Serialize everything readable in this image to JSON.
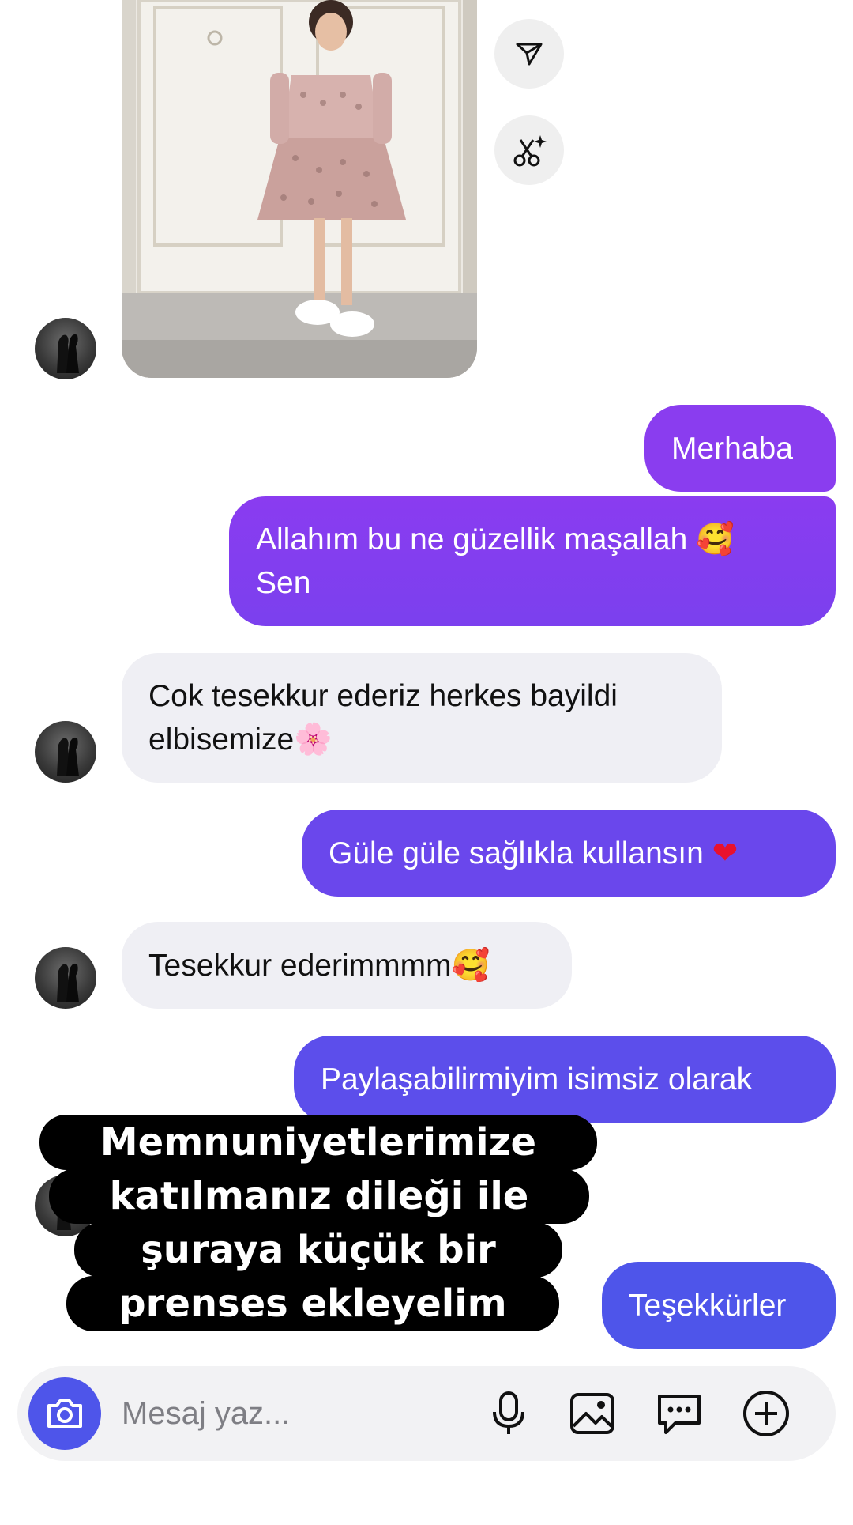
{
  "thread": {
    "photo_alt": "Shared photo: girl in a patterned dress",
    "messages": [
      {
        "id": "m1",
        "direction": "out",
        "text": "Merhaba"
      },
      {
        "id": "m2",
        "direction": "out",
        "line1": "Allahım bu ne güzellik maşallah",
        "emoji1": "🥰",
        "line2": "Sen"
      },
      {
        "id": "m3",
        "direction": "in",
        "line1": "Cok tesekkur ederiz herkes bayildi",
        "line2": "elbisemize",
        "emoji": "🌸"
      },
      {
        "id": "m4",
        "direction": "out",
        "text": "Güle güle sağlıkla kullansın",
        "emoji": "❤"
      },
      {
        "id": "m5",
        "direction": "in",
        "text": "Tesekkur ederimmmm",
        "emoji": "🥰"
      },
      {
        "id": "m6",
        "direction": "out",
        "text": "Paylaşabilirmiyim isimsiz olarak"
      },
      {
        "id": "m7",
        "direction": "out",
        "text": "Teşekkürler"
      }
    ]
  },
  "overlay": {
    "lines": [
      "Memnuniyetlerimize",
      "katılmanız dileği ile",
      "şuraya küçük bir",
      "prenses ekleyelim"
    ]
  },
  "composer": {
    "placeholder": "Mesaj yaz...",
    "icons": [
      "camera-icon",
      "microphone-icon",
      "gallery-icon",
      "chat-bubble-icon",
      "add-icon"
    ]
  },
  "colors": {
    "bubble_gradient_top": "#8b3cf0",
    "bubble_gradient_bottom": "#4e55ea",
    "incoming_bubble": "#efeff4",
    "camera_button": "#4e55ea"
  }
}
